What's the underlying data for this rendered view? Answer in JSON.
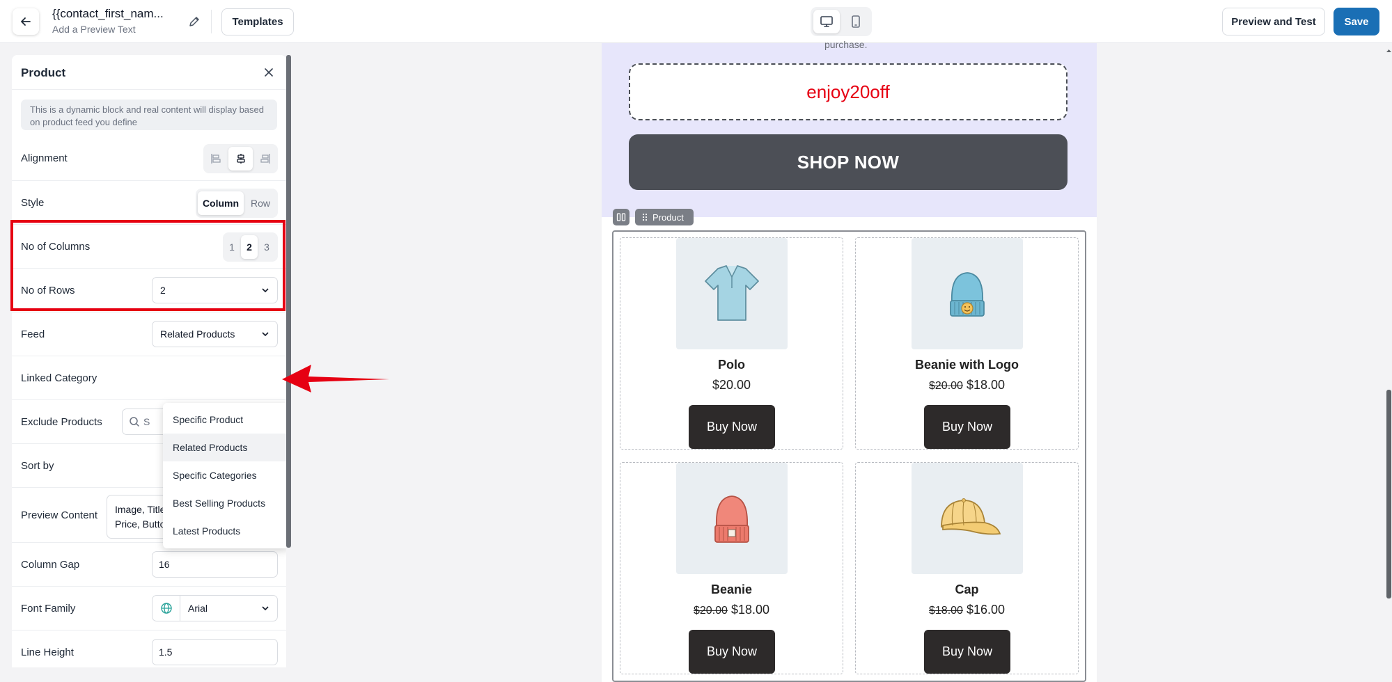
{
  "header": {
    "title": "{{contact_first_nam...",
    "subtitle": "Add a Preview Text",
    "templates_label": "Templates",
    "preview_label": "Preview and Test",
    "save_label": "Save",
    "accent_color": "#1a6fb5",
    "active_device": "desktop"
  },
  "panel": {
    "title": "Product",
    "notice": "This is a dynamic block and real content will display based on product feed you define",
    "alignment": {
      "label": "Alignment",
      "options": [
        "align-left-icon",
        "align-center-icon",
        "align-right-icon"
      ],
      "selected": "center"
    },
    "style": {
      "label": "Style",
      "options": [
        "Column",
        "Row"
      ],
      "selected": "Column"
    },
    "columns": {
      "label": "No of Columns",
      "options": [
        "1",
        "2",
        "3"
      ],
      "selected": "2"
    },
    "rows": {
      "label": "No of Rows",
      "value": "2"
    },
    "feed": {
      "label": "Feed",
      "value": "Related Products"
    },
    "feed_options": [
      "Specific Product",
      "Related Products",
      "Specific Categories",
      "Best Selling Products",
      "Latest Products"
    ],
    "linked_category": {
      "label": "Linked Category"
    },
    "exclude_products": {
      "label": "Exclude Products",
      "placeholder": "S"
    },
    "sort_by": {
      "label": "Sort by"
    },
    "preview_content": {
      "label": "Preview Content",
      "value": "Image, Title, Price, Regular Price, Button"
    },
    "column_gap": {
      "label": "Column Gap",
      "value": "16"
    },
    "font_family": {
      "label": "Font Family",
      "value": "Arial"
    },
    "line_height": {
      "label": "Line Height",
      "value": "1.5"
    }
  },
  "email": {
    "promo_partial_text": "purchase.",
    "coupon_code": "enjoy20off",
    "coupon_color": "#e60012",
    "shop_button": "SHOP NOW",
    "block_tag": "Product",
    "products": [
      {
        "title": "Polo",
        "old_price": "",
        "price": "$20.00",
        "button": "Buy Now",
        "image": "polo-shirt-image"
      },
      {
        "title": "Beanie with Logo",
        "old_price": "$20.00",
        "price": "$18.00",
        "button": "Buy Now",
        "image": "beanie-logo-image"
      },
      {
        "title": "Beanie",
        "old_price": "$20.00",
        "price": "$18.00",
        "button": "Buy Now",
        "image": "beanie-image"
      },
      {
        "title": "Cap",
        "old_price": "$18.00",
        "price": "$16.00",
        "button": "Buy Now",
        "image": "cap-image"
      }
    ]
  }
}
